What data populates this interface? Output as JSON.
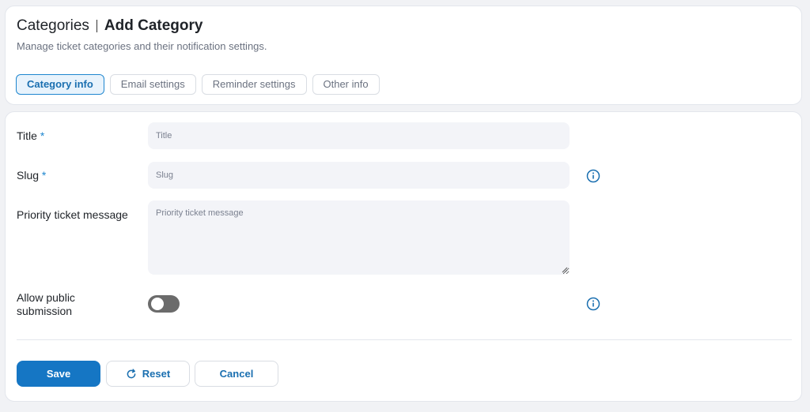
{
  "header": {
    "breadcrumb_root": "Categories",
    "page_title": "Add Category",
    "subtitle": "Manage ticket categories and their notification settings."
  },
  "tabs": [
    {
      "label": "Category info",
      "active": true
    },
    {
      "label": "Email settings",
      "active": false
    },
    {
      "label": "Reminder settings",
      "active": false
    },
    {
      "label": "Other info",
      "active": false
    }
  ],
  "form": {
    "title": {
      "label": "Title",
      "required_mark": "*",
      "value": "",
      "placeholder": "Title"
    },
    "slug": {
      "label": "Slug",
      "required_mark": "*",
      "value": "",
      "placeholder": "Slug",
      "icon": "info-icon"
    },
    "priority_message": {
      "label": "Priority ticket message",
      "value": "",
      "placeholder": "Priority ticket message"
    },
    "allow_public": {
      "label_line1": "Allow public",
      "label_line2": "submission",
      "enabled": false,
      "icon": "info-icon"
    }
  },
  "actions": {
    "save_label": "Save",
    "reset_label": "Reset",
    "reset_icon": "refresh-icon",
    "cancel_label": "Cancel"
  },
  "colors": {
    "accent": "#1576c4",
    "active_tab_bg": "#e8f3fc",
    "input_bg": "#f3f4f8",
    "toggle_off": "#6b6b6b"
  }
}
